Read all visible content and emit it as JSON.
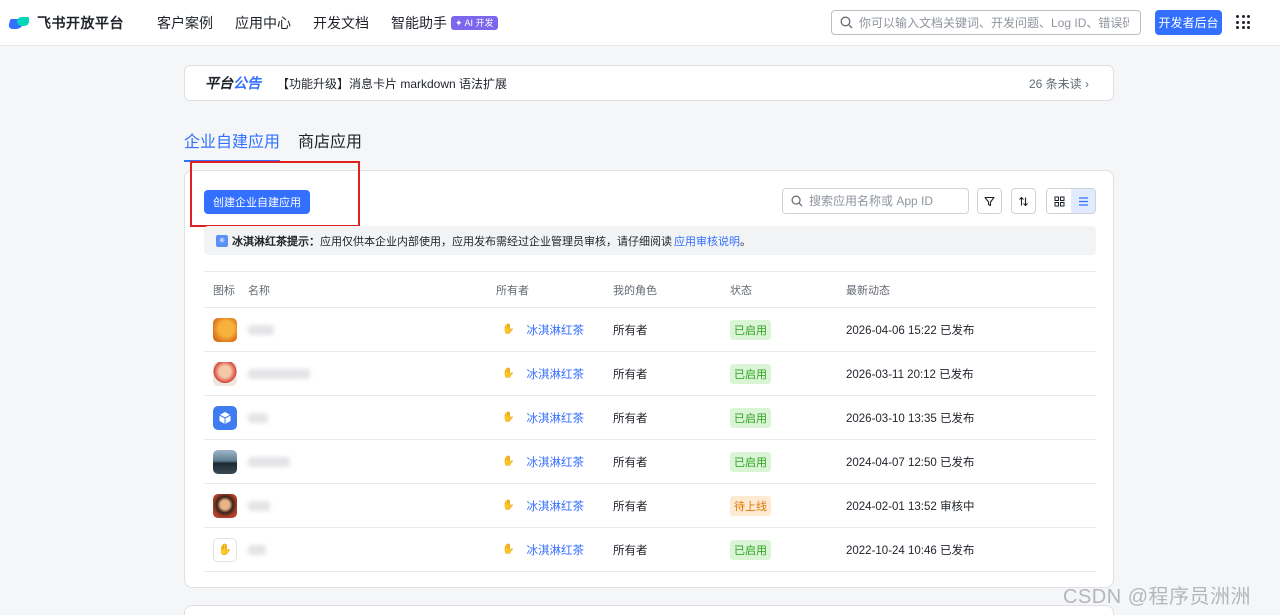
{
  "header": {
    "logo_text": "飞书开放平台",
    "nav": [
      {
        "label": "客户案例"
      },
      {
        "label": "应用中心"
      },
      {
        "label": "开发文档"
      },
      {
        "label": "智能助手",
        "badge": "✦ AI 开发"
      }
    ],
    "search_placeholder": "你可以输入文档关键词、开发问题、Log ID、错误码",
    "dev_console_label": "开发者后台"
  },
  "notice": {
    "title_part1": "平台",
    "title_part2": "公告",
    "text": "【功能升级】消息卡片 markdown 语法扩展",
    "unread": "26 条未读 ›"
  },
  "tabs": [
    {
      "label": "企业自建应用",
      "active": true
    },
    {
      "label": "商店应用",
      "active": false
    }
  ],
  "toolbar": {
    "create_label": "创建企业自建应用",
    "search_placeholder": "搜索应用名称或 App ID"
  },
  "tip": {
    "prefix": "冰淇淋红茶提示：",
    "text": "应用仅供本企业内部使用，应用发布需经过企业管理员审核，请仔细阅读",
    "link": "应用审核说明",
    "suffix": "。"
  },
  "table": {
    "columns": [
      "图标",
      "名称",
      "所有者",
      "我的角色",
      "状态",
      "最新动态"
    ],
    "rows": [
      {
        "icon": "orange-bird-icon",
        "owner": "冰淇淋红茶",
        "role": "所有者",
        "status": "已启用",
        "status_type": "on",
        "updated": "2026-04-06 15:22 已发布"
      },
      {
        "icon": "avatar-person-icon",
        "owner": "冰淇淋红茶",
        "role": "所有者",
        "status": "已启用",
        "status_type": "on",
        "updated": "2026-03-11 20:12 已发布"
      },
      {
        "icon": "blue-cube-icon",
        "owner": "冰淇淋红茶",
        "role": "所有者",
        "status": "已启用",
        "status_type": "on",
        "updated": "2026-03-10 13:35 已发布"
      },
      {
        "icon": "landscape-photo-icon",
        "owner": "冰淇淋红茶",
        "role": "所有者",
        "status": "已启用",
        "status_type": "on",
        "updated": "2024-04-07 12:50 已发布"
      },
      {
        "icon": "cartoon-face-icon",
        "owner": "冰淇淋红茶",
        "role": "所有者",
        "status": "待上线",
        "status_type": "wait",
        "updated": "2024-02-01 13:52 审核中"
      },
      {
        "icon": "yellow-hand-icon",
        "owner": "冰淇淋红茶",
        "role": "所有者",
        "status": "已启用",
        "status_type": "on",
        "updated": "2022-10-24 10:46 已发布"
      }
    ]
  },
  "watermark": "CSDN @程序员洲洲"
}
